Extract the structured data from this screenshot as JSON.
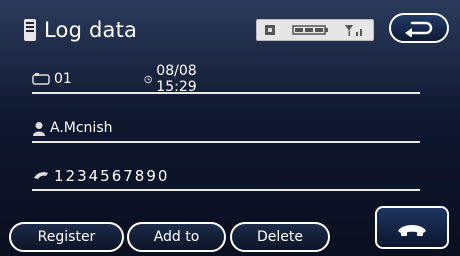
{
  "header": {
    "title": "Log data"
  },
  "record": {
    "index": "01",
    "datetime": "08/08 15:29",
    "name": "A.Mcnish",
    "number": "1234567890"
  },
  "buttons": {
    "register": "Register",
    "add_to": "Add to",
    "delete": "Delete"
  },
  "icons": {
    "title": "phone-document-icon",
    "index": "phone-log-icon",
    "time": "clock-icon",
    "name": "person-icon",
    "number": "phone-number-icon",
    "back": "back-arrow-icon",
    "call": "handset-icon",
    "status": [
      "bluetooth-icon",
      "battery-icon",
      "signal-icon"
    ]
  },
  "colors": {
    "background": "#0f1830",
    "accent": "#ffffff",
    "status_bar": "#e6e6e6"
  }
}
